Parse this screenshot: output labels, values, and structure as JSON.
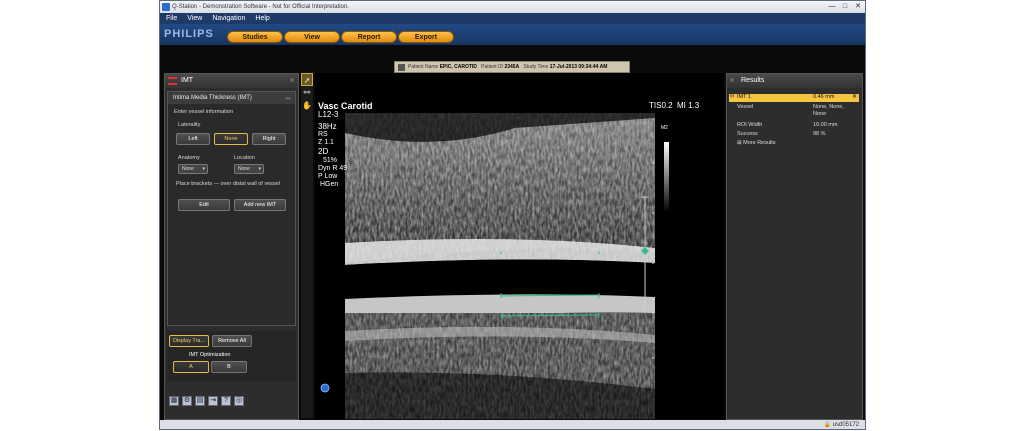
{
  "window": {
    "title": "Q-Station - Demonstration Software - Not for Official Interpretation.",
    "controls": [
      "—",
      "□",
      "✕"
    ]
  },
  "menu": [
    "File",
    "View",
    "Navigation",
    "Help"
  ],
  "brand": {
    "logo": "PHILIPS",
    "tabs": [
      "Studies",
      "View",
      "Report",
      "Export"
    ],
    "tab_color": "#f0a020"
  },
  "patient": {
    "name_label": "Patient Name",
    "name": "EPIC, CAROTID",
    "id_label": "Patient ID",
    "id": "2345A",
    "time_label": "Study Time",
    "time": "17-Jul-2013 09:34:44 AM"
  },
  "left_panel": {
    "title": "IMT",
    "section_title": "Intima Media Thickness (IMT)",
    "enter_info": "Enter vessel information",
    "laterality_label": "Laterality",
    "laterality_options": [
      "Left",
      "None",
      "Right"
    ],
    "laterality_selected": "None",
    "anatomy_label": "Anatomy",
    "anatomy_value": "None",
    "location_label": "Location",
    "location_value": "None",
    "bracket_hint": "Place brackets — over distal wall of vessel",
    "edit_label": "Edit",
    "add_label": "Add new IMT",
    "display_trace_label": "Display Tra...",
    "remove_all_label": "Remove All",
    "optimization_label": "IMT Optimization",
    "opt_a": "A",
    "opt_b": "B"
  },
  "overlay": {
    "left": [
      "Vasc Carotid",
      "L12-3",
      "38Hz",
      "RS",
      "Z 1.1",
      "2D",
      "51%",
      "Dyn R 49",
      "P Low",
      "HGen"
    ],
    "right": "TIS0.2  MI 1.3",
    "scale_label": "M2"
  },
  "results": {
    "title": "Results",
    "rows": [
      {
        "k": "IMT 1",
        "v": "0.46 mm"
      },
      {
        "k": "Vessel",
        "v": "None, None,"
      },
      {
        "k": "",
        "v": "None"
      },
      {
        "k": "ROI Width",
        "v": "10.00 mm"
      },
      {
        "k": "Success",
        "v": "98 %"
      }
    ],
    "more": "⊞ More Results",
    "highlight_color": "#f5c542"
  },
  "status": {
    "user": "usd05172"
  }
}
